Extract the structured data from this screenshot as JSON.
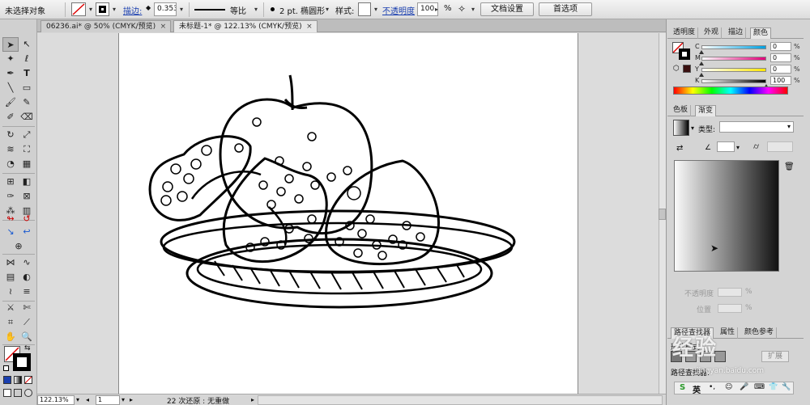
{
  "control_bar": {
    "selection_label": "未选择对象",
    "stroke_label": "描边:",
    "stroke_weight": "0.353",
    "profile_label": "等比",
    "brush_label": "2 pt. 椭圆形",
    "style_label": "样式:",
    "opacity_label": "不透明度",
    "opacity_value": "100",
    "opacity_unit": "%",
    "doc_setup_button": "文档设置",
    "preferences_button": "首选项"
  },
  "doc_tabs": [
    {
      "label": "06236.ai* @ 50% (CMYK/预览)"
    },
    {
      "label": "未标题-1* @ 122.13% (CMYK/预览)"
    }
  ],
  "status_bar": {
    "zoom": "122.13%",
    "page": "1",
    "message": "22 次还原 : 无重做"
  },
  "color_panel": {
    "tabs": [
      "透明度",
      "外观",
      "描边",
      "颜色"
    ],
    "channels": [
      {
        "label": "C",
        "value": "0",
        "unit": "%",
        "knob": 0.0
      },
      {
        "label": "M",
        "value": "0",
        "unit": "%",
        "knob": 0.0
      },
      {
        "label": "Y",
        "value": "0",
        "unit": "%",
        "knob": 0.0
      },
      {
        "label": "K",
        "value": "100",
        "unit": "%",
        "knob": 1.0
      }
    ]
  },
  "gradient_panel": {
    "tabs": [
      "色板",
      "渐变"
    ],
    "type_label": "类型:",
    "opacity_label": "不透明度",
    "location_label": "位置",
    "pct": "%"
  },
  "bottom_panel": {
    "tabs": [
      "路径查找器",
      "属性",
      "颜色参考"
    ],
    "shape_modes_label": "形状模式:",
    "expand_button": "扩展",
    "pathfinder_label": "路径查找器:",
    "ime_label": "英"
  },
  "watermark": {
    "text": "经验",
    "url": "jingyan.baidu.com"
  },
  "colors": {
    "stroke": "#000000",
    "fill": "#ffffff",
    "accent": "#1a3fb0"
  }
}
